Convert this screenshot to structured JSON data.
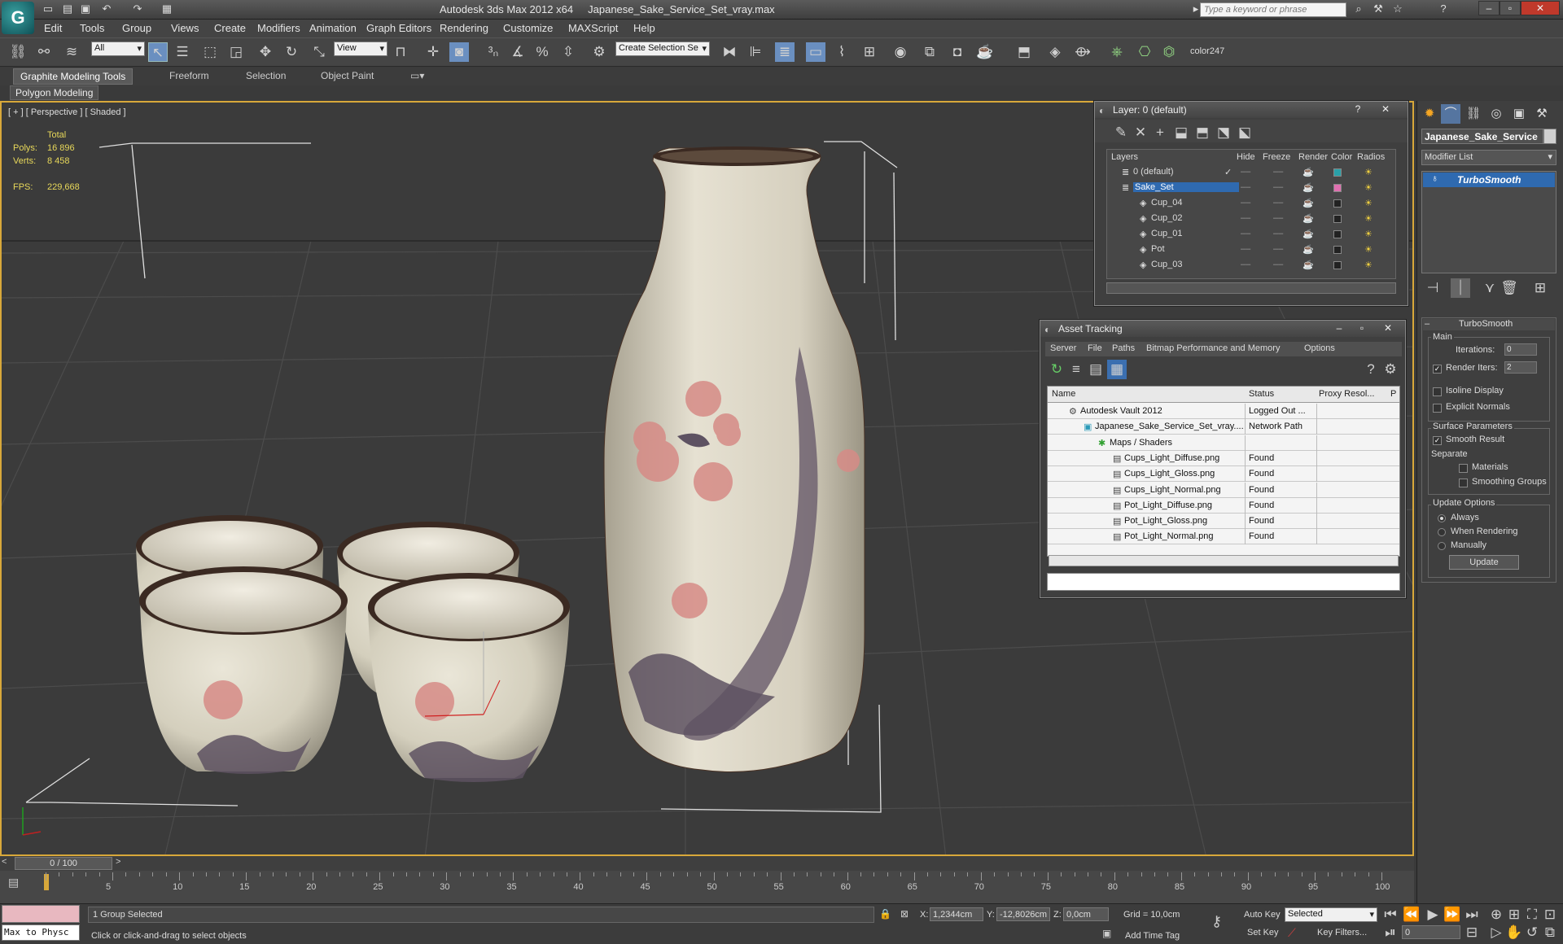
{
  "title_bar": {
    "app_title": "Autodesk 3ds Max  2012 x64",
    "file_name": "Japanese_Sake_Service_Set_vray.max",
    "search_placeholder": "Type a keyword or phrase",
    "logo_glyph": "G"
  },
  "menu": [
    "Edit",
    "Tools",
    "Group",
    "Views",
    "Create",
    "Modifiers",
    "Animation",
    "Graph Editors",
    "Rendering",
    "Customize",
    "MAXScript",
    "Help"
  ],
  "toolbar": {
    "filter_value": "All",
    "ref_coord_value": "View",
    "selection_set_value": "Create Selection Se",
    "color_label": "color247"
  },
  "ribbon": {
    "tabs": [
      "Graphite Modeling Tools",
      "Freeform",
      "Selection",
      "Object Paint"
    ],
    "panel_label": "Polygon Modeling"
  },
  "viewport": {
    "label": "[ + ] [ Perspective ] [ Shaded ]",
    "stats": {
      "total_label": "Total",
      "polys_label": "Polys:",
      "polys_value": "16 896",
      "verts_label": "Verts:",
      "verts_value": "8 458",
      "fps_label": "FPS:",
      "fps_value": "229,668"
    }
  },
  "layer_window": {
    "title": "Layer: 0 (default)",
    "columns": [
      "Layers",
      "Hide",
      "Freeze",
      "Render",
      "Color",
      "Radios"
    ],
    "rows": [
      {
        "name": "0 (default)",
        "color": "#2aa0a8",
        "selected": false,
        "indent": 0
      },
      {
        "name": "Sake_Set",
        "color": "#e070b0",
        "selected": true,
        "indent": 0
      },
      {
        "name": "Cup_04",
        "color": "#222222",
        "selected": false,
        "indent": 1
      },
      {
        "name": "Cup_02",
        "color": "#222222",
        "selected": false,
        "indent": 1
      },
      {
        "name": "Cup_01",
        "color": "#222222",
        "selected": false,
        "indent": 1
      },
      {
        "name": "Pot",
        "color": "#222222",
        "selected": false,
        "indent": 1
      },
      {
        "name": "Cup_03",
        "color": "#222222",
        "selected": false,
        "indent": 1
      }
    ]
  },
  "asset_window": {
    "title": "Asset Tracking",
    "menu": [
      "Server",
      "File",
      "Paths",
      "Bitmap Performance and Memory",
      "Options"
    ],
    "columns": [
      "Name",
      "Status",
      "Proxy Resol...",
      "P"
    ],
    "rows": [
      {
        "name": "Autodesk Vault 2012",
        "status": "Logged Out ...",
        "indent": 0
      },
      {
        "name": "Japanese_Sake_Service_Set_vray....",
        "status": "Network Path",
        "indent": 1
      },
      {
        "name": "Maps / Shaders",
        "status": "",
        "indent": 2
      },
      {
        "name": "Cups_Light_Diffuse.png",
        "status": "Found",
        "indent": 3
      },
      {
        "name": "Cups_Light_Gloss.png",
        "status": "Found",
        "indent": 3
      },
      {
        "name": "Cups_Light_Normal.png",
        "status": "Found",
        "indent": 3
      },
      {
        "name": "Pot_Light_Diffuse.png",
        "status": "Found",
        "indent": 3
      },
      {
        "name": "Pot_Light_Gloss.png",
        "status": "Found",
        "indent": 3
      },
      {
        "name": "Pot_Light_Normal.png",
        "status": "Found",
        "indent": 3
      }
    ]
  },
  "command_panel": {
    "object_name": "Japanese_Sake_Service",
    "modifier_list_label": "Modifier List",
    "modifier": "TurboSmooth",
    "rollout_title": "TurboSmooth",
    "main_label": "Main",
    "iterations_label": "Iterations:",
    "iterations_value": "0",
    "render_iters_label": "Render Iters:",
    "render_iters_value": "2",
    "isoline_label": "Isoline Display",
    "explicit_normals_label": "Explicit Normals",
    "surface_params_label": "Surface Parameters",
    "smooth_result_label": "Smooth Result",
    "separate_label": "Separate",
    "materials_label": "Materials",
    "smoothing_groups_label": "Smoothing Groups",
    "update_options_label": "Update Options",
    "always_label": "Always",
    "when_rendering_label": "When Rendering",
    "manually_label": "Manually",
    "update_button": "Update"
  },
  "timeline": {
    "frame_label": "0 / 100",
    "ticks": [
      "5",
      "10",
      "15",
      "20",
      "25",
      "30",
      "35",
      "40",
      "45",
      "50",
      "55",
      "60",
      "65",
      "70",
      "75",
      "80",
      "85",
      "90",
      "95",
      "100"
    ]
  },
  "status_bar": {
    "script_listener": "Max to Physc",
    "selection_status": "1 Group Selected",
    "prompt": "Click or click-and-drag to select objects",
    "x_label": "X:",
    "x_value": "1,2344cm",
    "y_label": "Y:",
    "y_value": "-12,8026cm",
    "z_label": "Z:",
    "z_value": "0,0cm",
    "grid": "Grid = 10,0cm",
    "add_time_tag": "Add Time Tag",
    "auto_key": "Auto Key",
    "set_key": "Set Key",
    "selected_dropdown": "Selected",
    "key_filters": "Key Filters...",
    "current_frame": "0"
  }
}
